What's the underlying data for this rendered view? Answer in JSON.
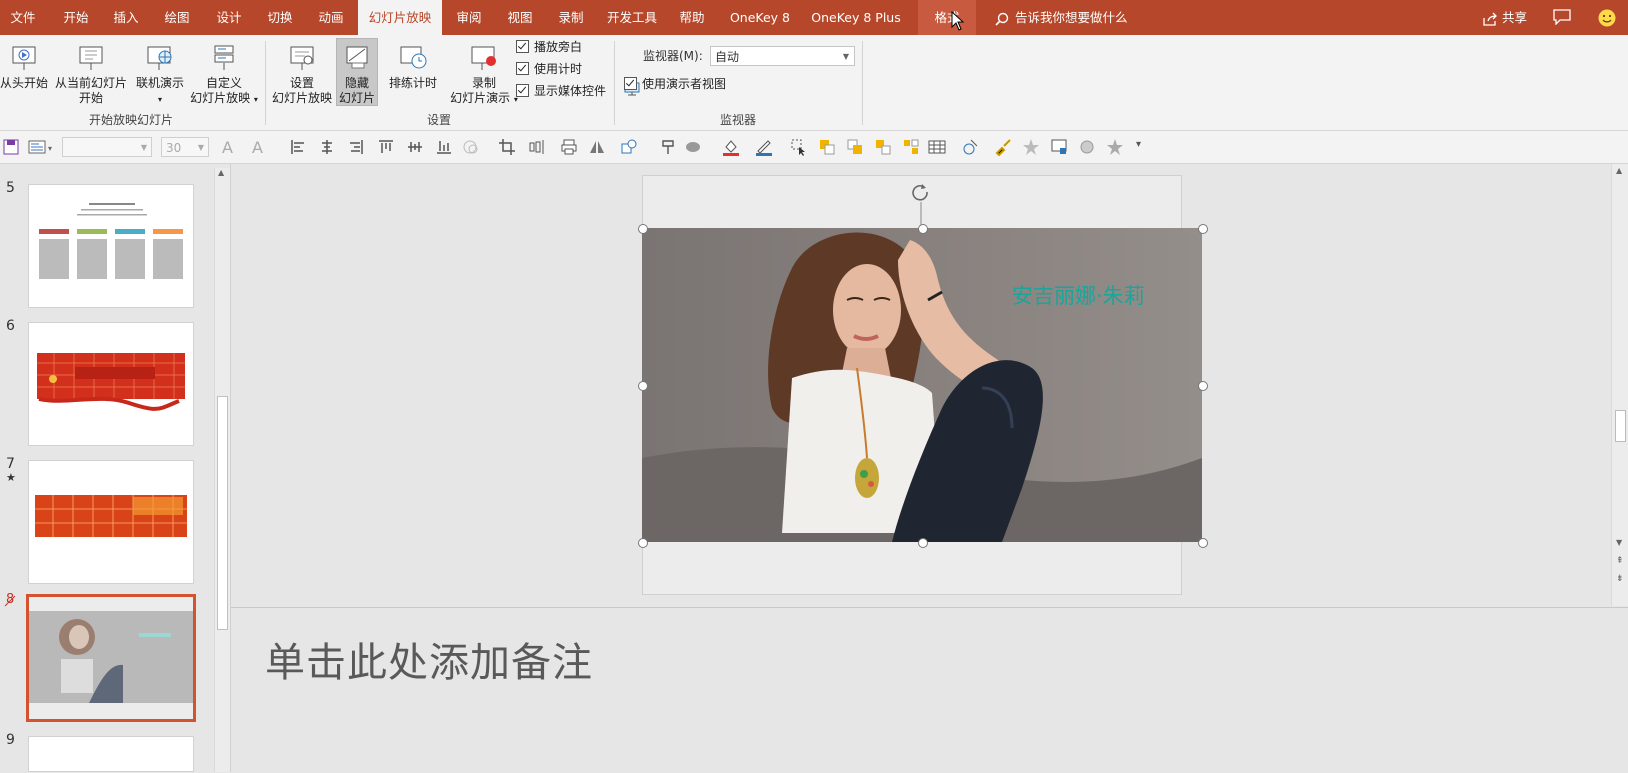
{
  "menu": {
    "tabs": [
      {
        "label": "文件"
      },
      {
        "label": "开始"
      },
      {
        "label": "插入"
      },
      {
        "label": "绘图"
      },
      {
        "label": "设计"
      },
      {
        "label": "切换"
      },
      {
        "label": "动画"
      },
      {
        "label": "幻灯片放映"
      },
      {
        "label": "审阅"
      },
      {
        "label": "视图"
      },
      {
        "label": "录制"
      },
      {
        "label": "开发工具"
      },
      {
        "label": "帮助"
      },
      {
        "label": "OneKey 8"
      },
      {
        "label": "OneKey 8 Plus"
      },
      {
        "label": "格式"
      }
    ],
    "active_tab": "幻灯片放映",
    "tell_me": "告诉我你想要做什么",
    "share": "共享"
  },
  "ribbon": {
    "start_show": {
      "from_beginning": "从头开始",
      "from_current_1": "从当前幻灯片",
      "from_current_2": "开始",
      "online": "联机演示",
      "custom_1": "自定义",
      "custom_2": "幻灯片放映",
      "group_label": "开始放映幻灯片"
    },
    "setup": {
      "setup_1": "设置",
      "setup_2": "幻灯片放映",
      "hide_1": "隐藏",
      "hide_2": "幻灯片",
      "rehearse": "排练计时",
      "record_1": "录制",
      "record_2": "幻灯片演示",
      "chk_narration": "播放旁白",
      "chk_timings": "使用计时",
      "chk_media": "显示媒体控件",
      "group_label": "设置"
    },
    "monitors": {
      "monitor_label": "监视器(M):",
      "monitor_value": "自动",
      "presenter_view": "使用演示者视图",
      "group_label": "监视器"
    }
  },
  "toolbar": {
    "font_size": "30"
  },
  "slides": [
    {
      "number": "5",
      "marker": ""
    },
    {
      "number": "6",
      "marker": ""
    },
    {
      "number": "7",
      "marker": "★"
    },
    {
      "number": "8",
      "marker": ""
    },
    {
      "number": "9",
      "marker": ""
    }
  ],
  "slide_canvas": {
    "caption": "安吉丽娜·朱莉"
  },
  "notes": {
    "placeholder": "单击此处添加备注"
  },
  "colors": {
    "accent": "#b7472a",
    "selection": "#d35230",
    "caption": "#1aa59a"
  }
}
